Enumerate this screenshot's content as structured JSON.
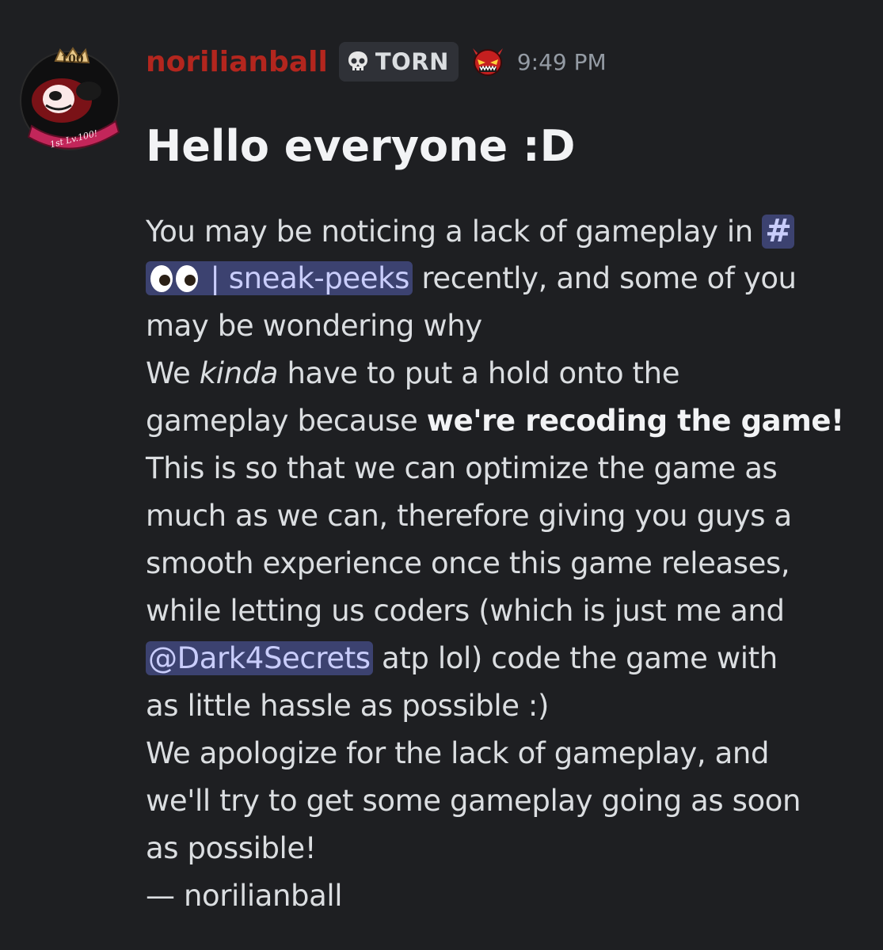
{
  "message": {
    "author": "norilianball",
    "tag": "TORN",
    "timestamp": "9:49 PM",
    "avatar_badge_top": "100",
    "avatar_badge_ribbon": "1st Lv.100!",
    "heading": "Hello everyone :D",
    "channel_mention": {
      "hash": "#",
      "name": "| sneak-peeks"
    },
    "user_mention": "@Dark4Secrets",
    "lines": {
      "l1": "You may be noticing a lack of gameplay in ",
      "l2_after": " recently, and some of you",
      "l3": "may be wondering why",
      "l4_pre": "We ",
      "l4_italic": "kinda",
      "l4_post": " have to put a hold onto the",
      "l5_pre": "gameplay because ",
      "l5_bold": "we're recoding the game!",
      "l6": "This is so that we can optimize the game as",
      "l7": "much as we can, therefore giving you guys a",
      "l8": "smooth experience once this game releases,",
      "l9": "while letting us coders (which is just me and",
      "l10_post": " atp lol) code the game with",
      "l11": "as little hassle as possible :)",
      "l12": "We apologize for the lack of gameplay, and",
      "l13": "we'll try to get some gameplay going as soon",
      "l14": "as possible!",
      "l15": "— norilianball"
    }
  },
  "colors": {
    "background": "#1e1f22",
    "username": "#b3261e",
    "mention_bg": "#3c4270",
    "mention_text": "#c9cdfb",
    "timestamp": "#949ba4"
  }
}
